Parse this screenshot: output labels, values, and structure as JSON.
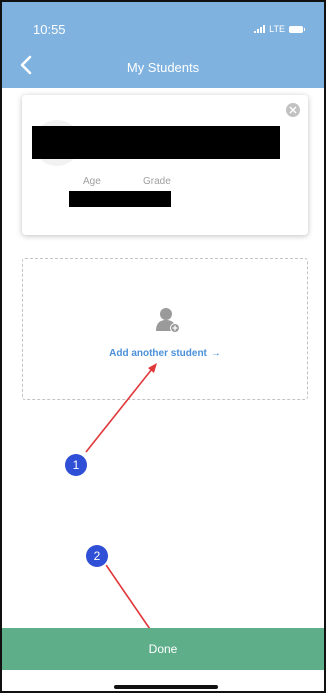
{
  "status_bar": {
    "time": "10:55",
    "network": "LTE"
  },
  "header": {
    "title": "My Students"
  },
  "student_card": {
    "age_label": "Age",
    "grade_label": "Grade"
  },
  "add_student": {
    "label": "Add another student",
    "arrow": "→"
  },
  "annotations": {
    "step1": "1",
    "step2": "2"
  },
  "footer": {
    "done_label": "Done"
  },
  "colors": {
    "header": "#7fb2df",
    "done_bar": "#5fae8a",
    "link": "#4a90d9",
    "annotation": "#2f4fd6",
    "arrow": "#e0383a"
  }
}
